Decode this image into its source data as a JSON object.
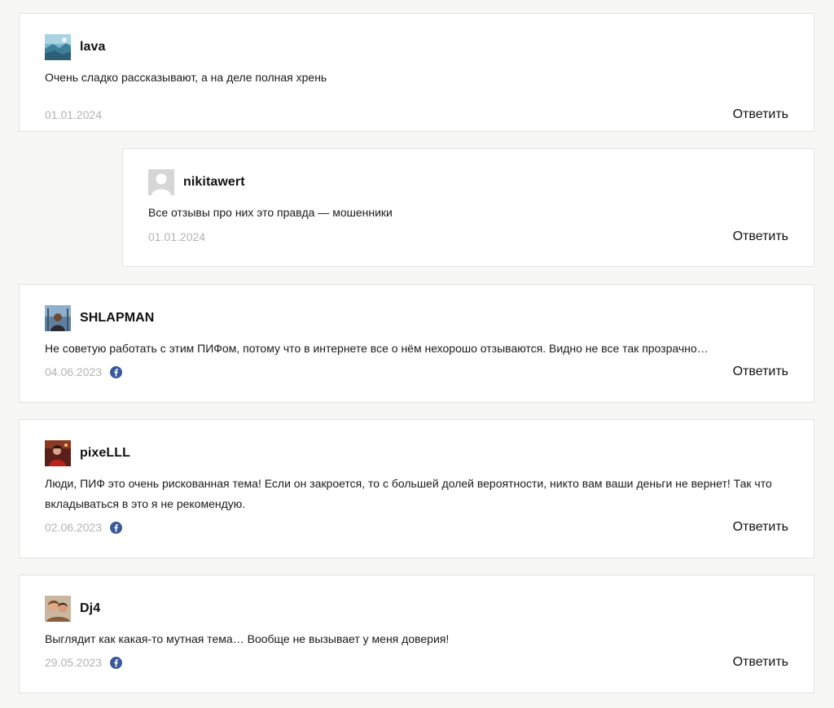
{
  "comments": [
    {
      "author": "lava",
      "avatar_icon": "landscape-photo-avatar",
      "text": "Очень сладко рассказывают, а на деле полная хрень",
      "date": "01.01.2024",
      "facebook": false,
      "reply_label": "Ответить"
    },
    {
      "author": "nikitawert",
      "avatar_icon": "default-user-avatar",
      "text": "Все отзывы про них это правда — мошенники",
      "date": "01.01.2024",
      "facebook": false,
      "reply_label": "Ответить",
      "is_reply": true
    },
    {
      "author": "SHLAPMAN",
      "avatar_icon": "person-photo-avatar",
      "text": "Не советую работать с этим ПИФом, потому что в интернете все о нём нехорошо отзываются. Видно не все так прозрачно…",
      "date": "04.06.2023",
      "facebook": true,
      "reply_label": "Ответить"
    },
    {
      "author": "pixeLLL",
      "avatar_icon": "person-photo-avatar",
      "text": "Люди, ПИФ это очень рискованная тема! Если он закроется, то с большей долей вероятности, никто вам ваши деньги не вернет! Так что вкладываться в это я не рекомендую.",
      "date": "02.06.2023",
      "facebook": true,
      "reply_label": "Ответить"
    },
    {
      "author": "Dj4",
      "avatar_icon": "couple-photo-avatar",
      "text": "Выглядит как какая-то мутная тема… Вообще не вызывает у меня доверия!",
      "date": "29.05.2023",
      "facebook": true,
      "reply_label": "Ответить"
    }
  ],
  "colors": {
    "background": "#f7f7f6",
    "card": "#ffffff",
    "border": "#e2e2e2",
    "date": "#b3b3b3",
    "facebook": "#3b5998"
  }
}
